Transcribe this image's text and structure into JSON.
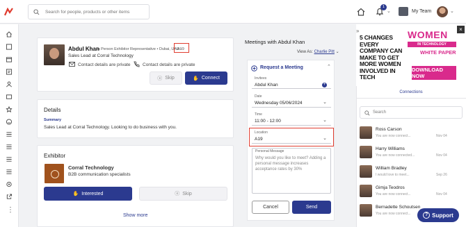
{
  "search": {
    "placeholder": "Search for people, products or other items"
  },
  "topbar": {
    "notification_count": "1",
    "team_label": "My Team"
  },
  "profile": {
    "name": "Abdul Khan",
    "meta": "In Person Exhibitor Representative • Dubai, UAE •",
    "location_code": "A19",
    "role": "Sales Lead at Corral Technology",
    "contact_private_1": "Contact details are private",
    "contact_private_2": "Contact details are private",
    "skip_label": "Skip",
    "connect_label": "Connect"
  },
  "details": {
    "title": "Details",
    "summary_label": "Summary",
    "summary_text": "Sales Lead at Corral Technology. Looking to do business with you."
  },
  "exhibitor": {
    "title": "Exhibitor",
    "company": "Corral Technology",
    "tagline": "B2B communication specialists",
    "interested_label": "Interested",
    "skip_label": "Skip",
    "show_more": "Show more"
  },
  "meetings": {
    "title": "Meetings with Abdul Khan",
    "view_as_label": "View As:",
    "view_as_value": "Charlie Pitt",
    "request_label": "Request a Meeting",
    "invitees_label": "Invitees",
    "invitees_value": "Abdul Khan",
    "date_label": "Date",
    "date_value": "Wednesday 05/06/2024",
    "time_label": "Time",
    "time_value": "11:00 - 12:00",
    "location_label": "Location",
    "location_value": "A19",
    "message_label": "Personal Message",
    "message_placeholder": "Why would you like to meet? Adding a personal message increases acceptance rates by 30%",
    "cancel_label": "Cancel",
    "send_label": "Send"
  },
  "ad": {
    "headline": "5 CHANGES EVERY COMPANY CAN MAKE TO GET MORE WOMEN INVOLVED IN TECH",
    "brand": "WOMEN",
    "brand_sub": "IN TECHNOLOGY",
    "white_paper": "WHITE PAPER",
    "download": "DOWNLOAD NOW"
  },
  "connections": {
    "tab_label": "Connections",
    "search_placeholder": "Search",
    "people": [
      {
        "name": "Ross Carson",
        "status": "You are now connect...",
        "date": "Nov 04"
      },
      {
        "name": "Harry Williams",
        "status": "You are now connected...",
        "date": "Nov 04"
      },
      {
        "name": "William Bradley",
        "status": "I would love to meet...",
        "date": "Sep 26"
      },
      {
        "name": "Gimja Teodros",
        "status": "You are now connect...",
        "date": "Nov 04"
      },
      {
        "name": "Bernadette Schoutsen",
        "status": "You are now connect...",
        "date": "Nov 04"
      }
    ]
  },
  "support": {
    "label": "Support"
  },
  "colors": {
    "primary": "#2b3a8f",
    "highlight": "#e03c2f",
    "ad_pink": "#d92a8c"
  }
}
